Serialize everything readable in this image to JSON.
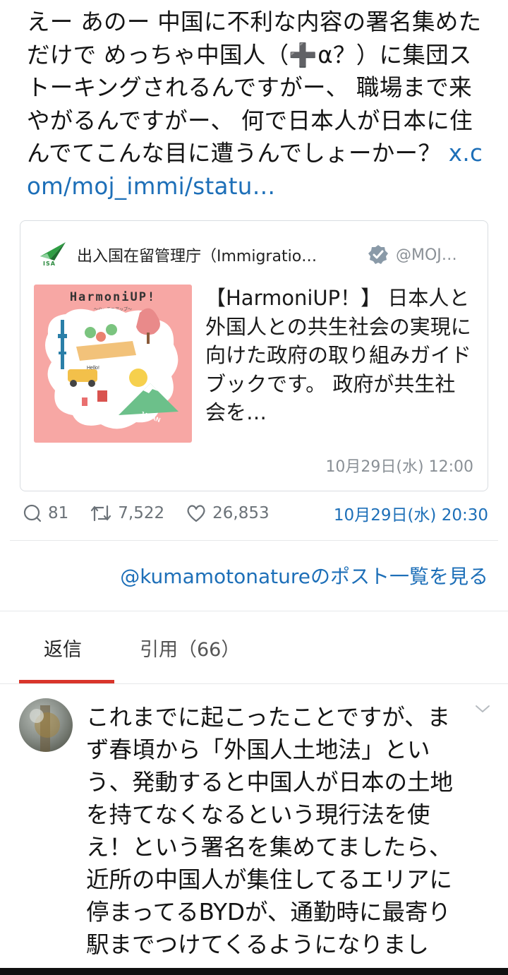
{
  "post": {
    "text": "えー あのー 中国に不利な内容の署名集めただけで めっちゃ中国人（➕α？）に集団ストーキングされるんですがー、 職場まで来やがるんですがー、 何で日本人が日本に住んでてこんな目に遭うんでしょーかー？ ",
    "link": "x.com/moj_immi/statu…"
  },
  "quote": {
    "logo_text": "ISA",
    "name": "出入国在留管理庁（Immigratio…",
    "handle": "@MOJ…",
    "thumbnail": {
      "title": "HarmoniUP!",
      "subtitle": "〜ハーモニアップ〜",
      "label": "JAPAN",
      "sign": "Hello!"
    },
    "body": "【HarmoniUP！】 日本人と外国人との共生社会の実現に向けた政府の取り組みガイドブックです。 政府が共生社会を…",
    "time": "10月29日(水) 12:00"
  },
  "actions": {
    "replies": "81",
    "reposts": "7,522",
    "likes": "26,853",
    "time": "10月29日(水) 20:30"
  },
  "more_link": "@kumamotonatureのポスト一覧を見る",
  "tabs": [
    "返信",
    "引用（66）"
  ],
  "reply": {
    "text": "これまでに起こったことですが、まず春頃から「外国人土地法」という、発動すると中国人が日本の土地を持てなくなるという現行法を使え！という署名を集めてましたら、近所の中国人が集住してるエリアに停まってるBYDが、通勤時に最寄り駅までつけてくるようになりまし"
  },
  "colors": {
    "link": "#1d6fb8",
    "tab_accent": "#d9352b",
    "verified": "#8a9aa8",
    "thumbnail_bg": "#f7a7a4"
  },
  "icons": [
    "paper-plane-logo-icon",
    "verified-badge-icon",
    "reply-icon",
    "repost-icon",
    "like-icon",
    "chevron-down-icon"
  ]
}
